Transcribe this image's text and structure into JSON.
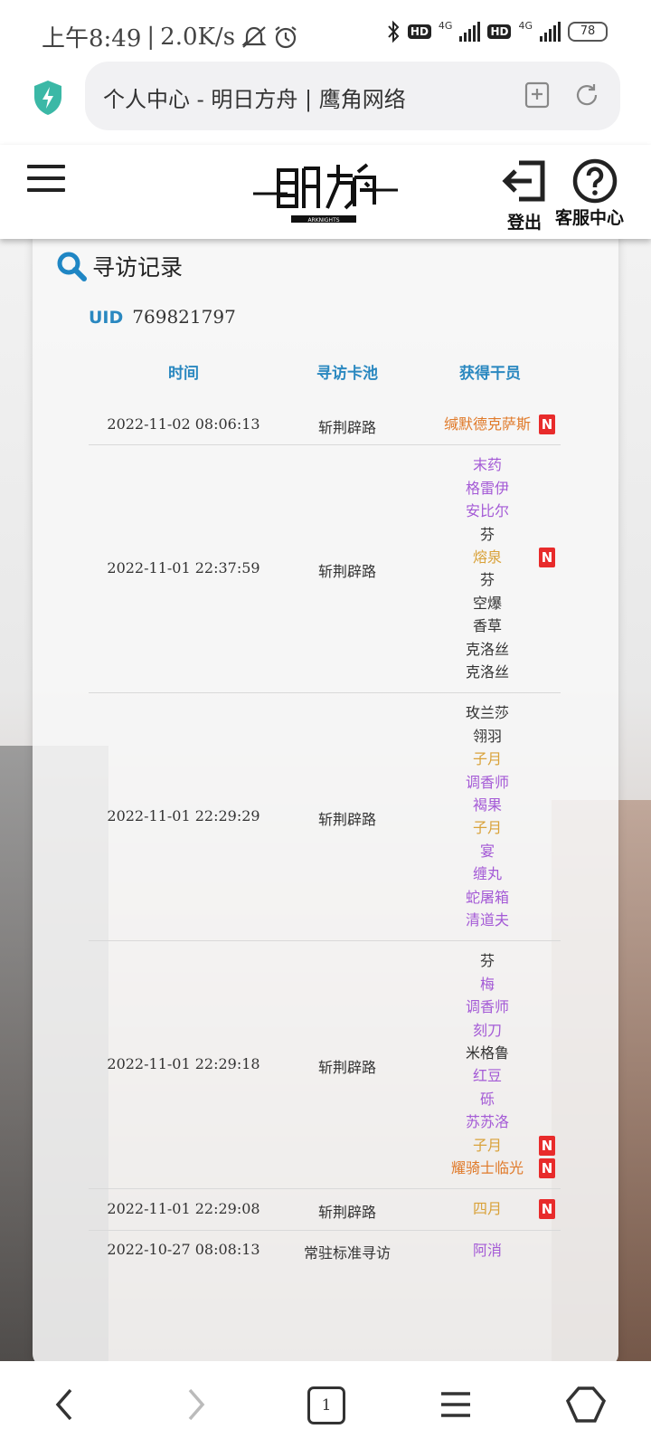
{
  "status_bar": {
    "time": "上午8:49",
    "speed": "2.0K/s",
    "hd": "HD",
    "net": "4G",
    "battery": "78"
  },
  "browser": {
    "address": "个人中心 - 明日方舟 | 鹰角网络"
  },
  "header": {
    "logout_label": "登出",
    "support_label": "客服中心",
    "logo_sub": "ARKNIGHTS"
  },
  "card": {
    "title": "寻访记录",
    "uid_label": "UID",
    "uid_value": "769821797",
    "columns": {
      "time": "时间",
      "pool": "寻访卡池",
      "operators": "获得干员"
    }
  },
  "records": [
    {
      "time": "2022-11-02 08:06:13",
      "pool": "斩荆辟路",
      "operators": [
        {
          "name": "缄默德克萨斯",
          "rarity": 6,
          "new": true
        }
      ]
    },
    {
      "time": "2022-11-01 22:37:59",
      "pool": "斩荆辟路",
      "operators": [
        {
          "name": "末药",
          "rarity": 4,
          "new": false
        },
        {
          "name": "格雷伊",
          "rarity": 4,
          "new": false
        },
        {
          "name": "安比尔",
          "rarity": 4,
          "new": false
        },
        {
          "name": "芬",
          "rarity": 3,
          "new": false
        },
        {
          "name": "熔泉",
          "rarity": 5,
          "new": true
        },
        {
          "name": "芬",
          "rarity": 3,
          "new": false
        },
        {
          "name": "空爆",
          "rarity": 3,
          "new": false
        },
        {
          "name": "香草",
          "rarity": 3,
          "new": false
        },
        {
          "name": "克洛丝",
          "rarity": 3,
          "new": false
        },
        {
          "name": "克洛丝",
          "rarity": 3,
          "new": false
        }
      ]
    },
    {
      "time": "2022-11-01 22:29:29",
      "pool": "斩荆辟路",
      "operators": [
        {
          "name": "玫兰莎",
          "rarity": 3,
          "new": false
        },
        {
          "name": "翎羽",
          "rarity": 3,
          "new": false
        },
        {
          "name": "子月",
          "rarity": 5,
          "new": false
        },
        {
          "name": "调香师",
          "rarity": 4,
          "new": false
        },
        {
          "name": "褐果",
          "rarity": 4,
          "new": false
        },
        {
          "name": "子月",
          "rarity": 5,
          "new": false
        },
        {
          "name": "宴",
          "rarity": 4,
          "new": false
        },
        {
          "name": "缠丸",
          "rarity": 4,
          "new": false
        },
        {
          "name": "蛇屠箱",
          "rarity": 4,
          "new": false
        },
        {
          "name": "清道夫",
          "rarity": 4,
          "new": false
        }
      ]
    },
    {
      "time": "2022-11-01 22:29:18",
      "pool": "斩荆辟路",
      "operators": [
        {
          "name": "芬",
          "rarity": 3,
          "new": false
        },
        {
          "name": "梅",
          "rarity": 4,
          "new": false
        },
        {
          "name": "调香师",
          "rarity": 4,
          "new": false
        },
        {
          "name": "刻刀",
          "rarity": 4,
          "new": false
        },
        {
          "name": "米格鲁",
          "rarity": 3,
          "new": false
        },
        {
          "name": "红豆",
          "rarity": 4,
          "new": false
        },
        {
          "name": "砾",
          "rarity": 4,
          "new": false
        },
        {
          "name": "苏苏洛",
          "rarity": 4,
          "new": false
        },
        {
          "name": "子月",
          "rarity": 5,
          "new": true
        },
        {
          "name": "耀骑士临光",
          "rarity": 6,
          "new": true
        }
      ]
    },
    {
      "time": "2022-11-01 22:29:08",
      "pool": "斩荆辟路",
      "operators": [
        {
          "name": "四月",
          "rarity": 5,
          "new": true
        }
      ]
    },
    {
      "time": "2022-10-27 08:08:13",
      "pool": "常驻标准寻访",
      "operators": [
        {
          "name": "阿消",
          "rarity": 4,
          "new": false
        }
      ]
    }
  ],
  "badge_new": "N",
  "nav": {
    "tabs_count": "1"
  },
  "colors": {
    "accent": "#2a88c0",
    "rarity3": "#333333",
    "rarity4": "#a45ad6",
    "rarity5": "#d9a23a",
    "rarity6": "#e07a2a",
    "new_badge": "#e82b2b"
  }
}
